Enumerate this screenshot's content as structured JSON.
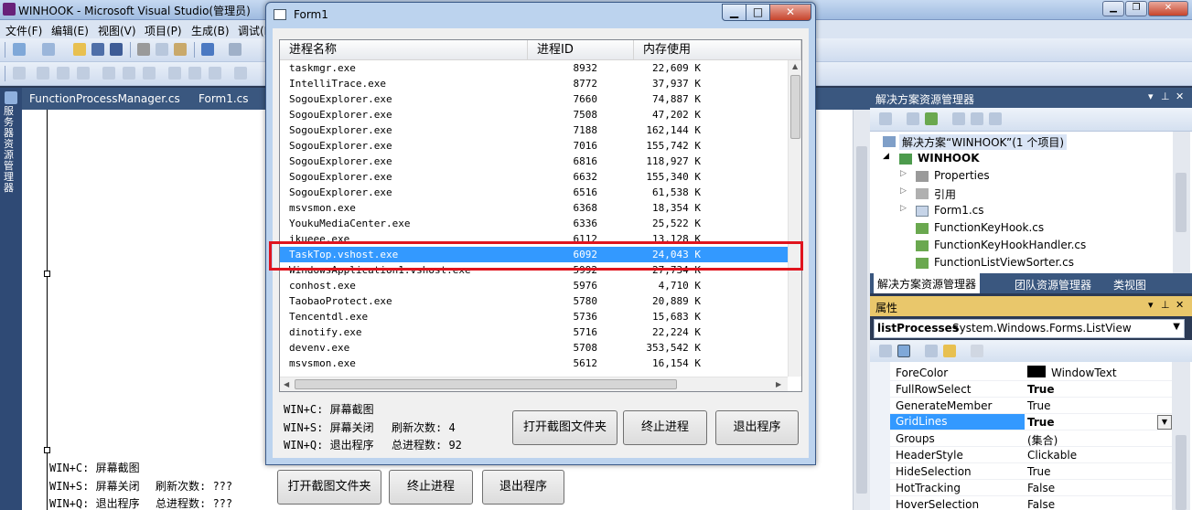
{
  "vs": {
    "title": "WINHOOK - Microsoft Visual Studio(管理员)",
    "menu": [
      "文件(F)",
      "编辑(E)",
      "视图(V)",
      "项目(P)",
      "生成(B)",
      "调试(D)"
    ],
    "left_toolbox": "服务器资源管理器",
    "doc_tabs": [
      "FunctionProcessManager.cs",
      "Form1.cs"
    ],
    "designer": {
      "label_line1": "WIN+C: 屏幕截图",
      "label_line2": "WIN+S: 屏幕关闭",
      "label_line3": "WIN+Q: 退出程序",
      "refresh_label": "刷新次数: ???",
      "total_label": "总进程数: ???",
      "btn_open": "打开截图文件夹",
      "btn_kill": "终止进程",
      "btn_exit": "退出程序"
    }
  },
  "form1": {
    "title": "Form1",
    "columns": [
      "进程名称",
      "进程ID",
      "内存使用"
    ],
    "rows": [
      {
        "name": "taskmgr.exe",
        "pid": "8932",
        "mem": "22,609 K"
      },
      {
        "name": "IntelliTrace.exe",
        "pid": "8772",
        "mem": "37,937 K"
      },
      {
        "name": "SogouExplorer.exe",
        "pid": "7660",
        "mem": "74,887 K"
      },
      {
        "name": "SogouExplorer.exe",
        "pid": "7508",
        "mem": "47,202 K"
      },
      {
        "name": "SogouExplorer.exe",
        "pid": "7188",
        "mem": "162,144 K"
      },
      {
        "name": "SogouExplorer.exe",
        "pid": "7016",
        "mem": "155,742 K"
      },
      {
        "name": "SogouExplorer.exe",
        "pid": "6816",
        "mem": "118,927 K"
      },
      {
        "name": "SogouExplorer.exe",
        "pid": "6632",
        "mem": "155,340 K"
      },
      {
        "name": "SogouExplorer.exe",
        "pid": "6516",
        "mem": "61,538 K"
      },
      {
        "name": "msvsmon.exe",
        "pid": "6368",
        "mem": "18,354 K"
      },
      {
        "name": "YoukuMediaCenter.exe",
        "pid": "6336",
        "mem": "25,522 K"
      },
      {
        "name": "ikueee.exe",
        "pid": "6112",
        "mem": "13,128 K"
      },
      {
        "name": "TaskTop.vshost.exe",
        "pid": "6092",
        "mem": "24,043 K",
        "selected": true
      },
      {
        "name": "WindowsApplication1.vshost.exe",
        "pid": "5992",
        "mem": "27,734 K"
      },
      {
        "name": "conhost.exe",
        "pid": "5976",
        "mem": "4,710 K"
      },
      {
        "name": "TaobaoProtect.exe",
        "pid": "5780",
        "mem": "20,889 K"
      },
      {
        "name": "Tencentdl.exe",
        "pid": "5736",
        "mem": "15,683 K"
      },
      {
        "name": "dinotify.exe",
        "pid": "5716",
        "mem": "22,224 K"
      },
      {
        "name": "devenv.exe",
        "pid": "5708",
        "mem": "353,542 K"
      },
      {
        "name": "msvsmon.exe",
        "pid": "5612",
        "mem": "16,154 K"
      }
    ],
    "label_line1": "WIN+C: 屏幕截图",
    "label_line2": "WIN+S: 屏幕关闭",
    "label_line3": "WIN+Q: 退出程序",
    "refresh_label": "刷新次数: 4",
    "total_label": "总进程数: 92",
    "btn_open": "打开截图文件夹",
    "btn_kill": "终止进程",
    "btn_exit": "退出程序"
  },
  "solution_explorer": {
    "title": "解决方案资源管理器",
    "solution": "解决方案“WINHOOK”(1 个项目)",
    "project": "WINHOOK",
    "items": [
      "Properties",
      "引用",
      "Form1.cs",
      "FunctionKeyHook.cs",
      "FunctionKeyHookHandler.cs",
      "FunctionListViewSorter.cs"
    ],
    "tabs": [
      "解决方案资源管理器",
      "团队资源管理器",
      "类视图"
    ]
  },
  "properties": {
    "title": "属性",
    "object_name": "listProcesses",
    "object_type": "System.Windows.Forms.ListView",
    "rows": [
      {
        "key": "ForeColor",
        "value": "WindowText"
      },
      {
        "key": "FullRowSelect",
        "value": "True",
        "bold": true
      },
      {
        "key": "GenerateMember",
        "value": "True"
      },
      {
        "key": "GridLines",
        "value": "True",
        "bold": true,
        "selected": true
      },
      {
        "key": "Groups",
        "value": "(集合)"
      },
      {
        "key": "HeaderStyle",
        "value": "Clickable"
      },
      {
        "key": "HideSelection",
        "value": "True"
      },
      {
        "key": "HotTracking",
        "value": "False"
      },
      {
        "key": "HoverSelection",
        "value": "False"
      }
    ]
  },
  "colors": {
    "selection": "#3399ff",
    "highlight_box": "#e0141e",
    "panel_dark": "#3a577f"
  }
}
